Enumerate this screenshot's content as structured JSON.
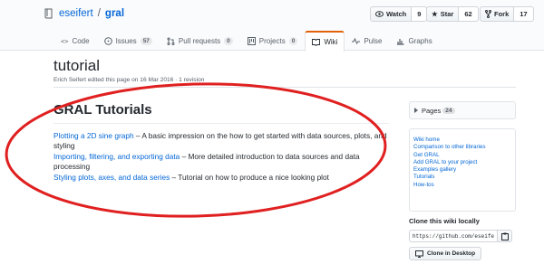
{
  "repo": {
    "owner": "eseifert",
    "separator": "/",
    "name": "gral"
  },
  "actions": {
    "watch": {
      "label": "Watch",
      "count": "9"
    },
    "star": {
      "label": "Star",
      "count": "62"
    },
    "fork": {
      "label": "Fork",
      "count": "17"
    }
  },
  "tabs": [
    {
      "label": "Code",
      "icon": "code-icon"
    },
    {
      "label": "Issues",
      "count": "57",
      "icon": "issue-icon"
    },
    {
      "label": "Pull requests",
      "count": "0",
      "icon": "pull-request-icon"
    },
    {
      "label": "Projects",
      "count": "0",
      "icon": "project-icon"
    },
    {
      "label": "Wiki",
      "icon": "book-icon",
      "selected": true
    },
    {
      "label": "Pulse",
      "icon": "pulse-icon"
    },
    {
      "label": "Graphs",
      "icon": "graph-icon"
    }
  ],
  "page": {
    "title": "tutorial",
    "meta": "Erich Seifert edited this page on 16 Mar 2016 · 1 revision"
  },
  "content": {
    "heading": "GRAL Tutorials",
    "items": [
      {
        "link": "Plotting a 2D sine graph",
        "text": " – A basic impression on the how to get started with data sources, plots, and styling"
      },
      {
        "link": "Importing, filtering, and exporting data",
        "text": " – More detailed introduction to data sources and data processing"
      },
      {
        "link": "Styling plots, axes, and data series",
        "text": " – Tutorial on how to produce a nice looking plot"
      }
    ]
  },
  "sidebar": {
    "pages_label": "Pages",
    "pages_count": "24",
    "links": [
      "Wiki home",
      "Comparison to other libraries",
      "Get GRAL",
      "Add GRAL to your project",
      "Examples gallery",
      "Tutorials",
      "How-tos"
    ]
  },
  "clone": {
    "title": "Clone this wiki locally",
    "url": "https://github.com/eseifert/gral.wiki.git",
    "desktop_label": "Clone in Desktop"
  },
  "colors": {
    "link": "#0366d6",
    "tab_accent": "#e36209",
    "annotation": "#e02020"
  }
}
